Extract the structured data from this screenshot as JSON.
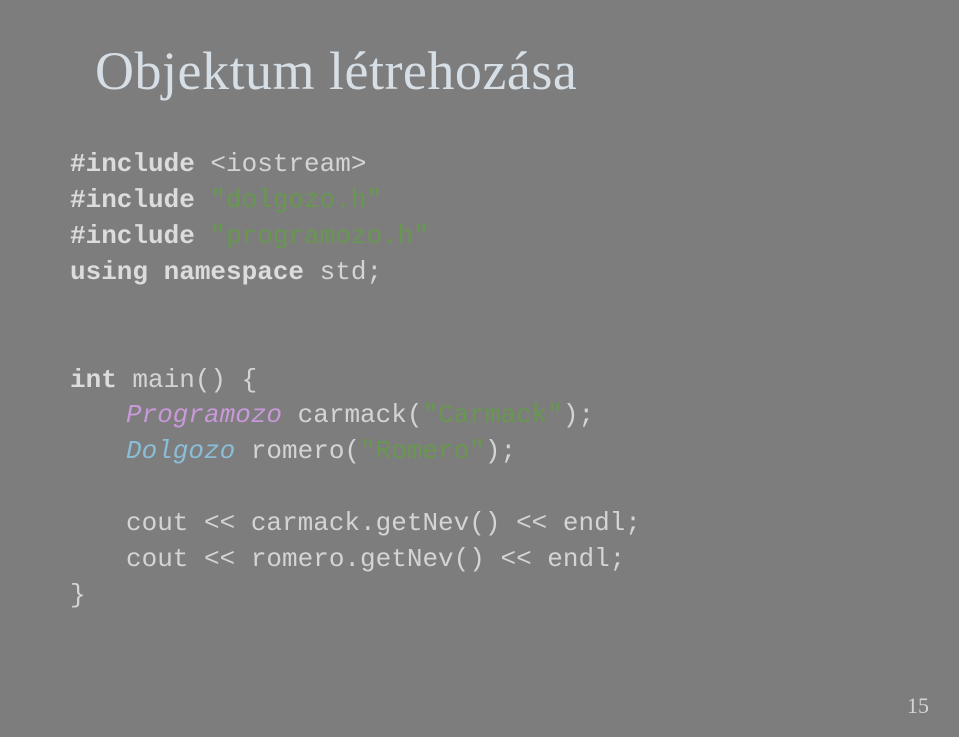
{
  "slide": {
    "title": "Objektum létrehozása",
    "pageNumber": "15"
  },
  "code": {
    "include1_kw": "#include",
    "include1_arg": " <iostream>",
    "include2_kw": "#include",
    "include2_arg": " \"dolgozo.h\"",
    "include3_kw": "#include",
    "include3_arg": " \"programozo.h\"",
    "using_kw": "using namespace",
    "using_arg": " std;",
    "int_kw": "int",
    "main_sig": " main() {",
    "line_programozo_type": "Programozo",
    "line_programozo_rest": " carmack(",
    "line_programozo_str": "\"Carmack\"",
    "line_programozo_end": ");",
    "line_dolgozo_type": "Dolgozo",
    "line_dolgozo_rest": " romero(",
    "line_dolgozo_str": "\"Romero\"",
    "line_dolgozo_end": ");",
    "cout1_a": "cout << carmack.getNev() << endl;",
    "cout2_a": "cout << romero.getNev() << endl;",
    "close_brace": "}"
  }
}
